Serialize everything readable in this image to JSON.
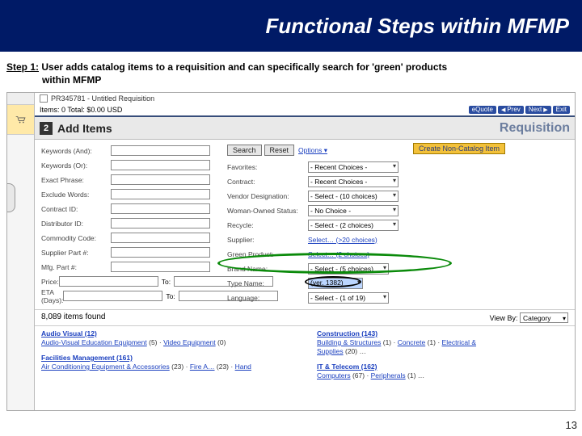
{
  "title_bar": "Functional Steps within MFMP",
  "step": {
    "label": "Step 1:",
    "text_a": "User adds catalog items to a requisition and can specifically search for 'green' products",
    "text_b": "within MFMP"
  },
  "breadcrumb": "PR345781 - Untitled Requisition",
  "items_total": "Items: 0  Total: $0.00 USD",
  "nav": {
    "equote": "eQuote",
    "prev": "Prev",
    "next": "Next",
    "exit": "Exit"
  },
  "section": {
    "num": "2",
    "title": "Add Items",
    "context": "Requisition"
  },
  "left_labels": {
    "kw_and": "Keywords (And):",
    "kw_or": "Keywords (Or):",
    "exact": "Exact Phrase:",
    "exclude": "Exclude Words:",
    "contract_id": "Contract ID:",
    "distributor_id": "Distributor ID:",
    "commodity": "Commodity Code:",
    "supp_part": "Supplier Part #:",
    "mfg_part": "Mfg. Part #:",
    "price": "Price:",
    "eta": "ETA (Days):",
    "to": "To:"
  },
  "mid_labels": {
    "favorites": "Favorites:",
    "contract": "Contract:",
    "vendor_des": "Vendor Designation:",
    "woman": "Woman-Owned Status:",
    "recycle": "Recycle:",
    "supplier": "Supplier:",
    "green": "Green Product:",
    "brand": "Brand Name:",
    "type_name": "Type Name:",
    "language": "Language:"
  },
  "mid_values": {
    "favorites": "- Recent Choices -",
    "contract": "- Recent Choices -",
    "vendor_des": "- Select - (10 choices)",
    "woman": "- No Choice -",
    "recycle": "- Select - (2 choices)",
    "supplier": "Select… (>20 choices)",
    "green": "Select… (2 choices)",
    "brand": "- Select - (5 choices)",
    "type_name": "(ver. 1382)",
    "language": "- Select - (1 of 19)"
  },
  "btns": {
    "search": "Search",
    "reset": "Reset",
    "options": "Options ▾",
    "noncat": "Create Non-Catalog Item"
  },
  "results": {
    "count": "8,089 items found",
    "view_by_label": "View By:",
    "view_by_value": "Category"
  },
  "cats": {
    "a1_h": "Audio Visual (12)",
    "a1_s1": "Audio-Visual Education Equipment",
    "a1_s1n": "(5)",
    "a1_s2": "Video Equipment",
    "a1_s2n": "(0)",
    "a2_h": "Facilities Management (161)",
    "a2_s1": "Air Conditioning Equipment & Accessories",
    "a2_s1n": "(23)",
    "a2_s2": "Fire A…",
    "a2_s2n": "(23)",
    "a2_s3": "Hand",
    "b1_h": "Construction (143)",
    "b1_s1": "Building & Structures",
    "b1_s1n": "(1)",
    "b1_s2": "Concrete",
    "b1_s2n": "(1)",
    "b1_s3": "Electrical &",
    "b1_s4": "Supplies",
    "b1_s4n": "(20)",
    "b2_h": "IT & Telecom (162)",
    "b2_s1": "Computers",
    "b2_s1n": "(67)",
    "b2_s2": "Peripherals",
    "b2_s2n": "(1)"
  },
  "page_number": "13"
}
